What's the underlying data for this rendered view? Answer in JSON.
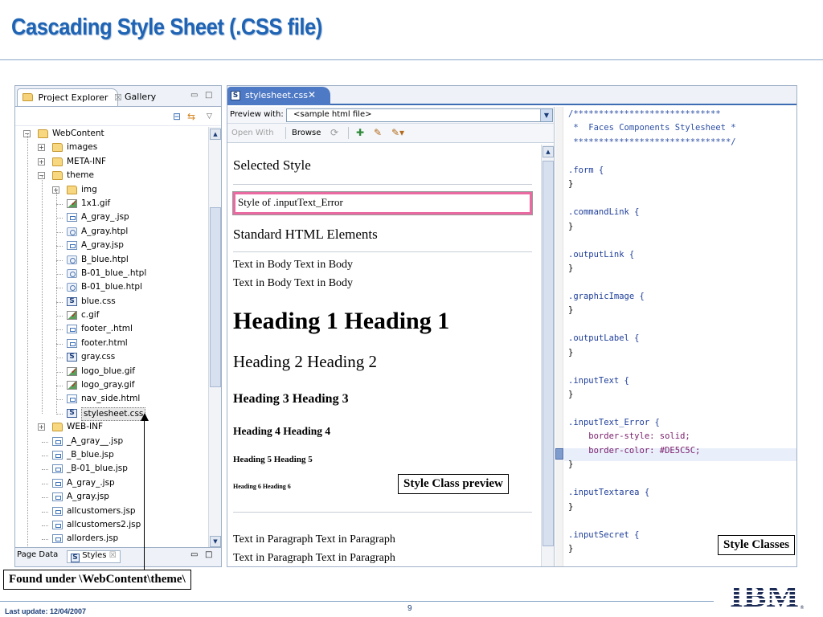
{
  "slide": {
    "title": "Cascading Style Sheet (.CSS file)",
    "footer_left": "Last update: 12/04/2007",
    "page_number": "9",
    "logo_text": "IBM"
  },
  "explorer": {
    "tabs": [
      {
        "label": "Project Explorer",
        "close": "☒",
        "icon": "folder-icon"
      },
      {
        "label": "Gallery"
      }
    ],
    "tree": [
      {
        "label": "WebContent",
        "depth": 0,
        "type": "folder",
        "expander": "−"
      },
      {
        "label": "images",
        "depth": 1,
        "type": "folder",
        "expander": "+"
      },
      {
        "label": "META-INF",
        "depth": 1,
        "type": "folder",
        "expander": "+"
      },
      {
        "label": "theme",
        "depth": 1,
        "type": "folder",
        "expander": "−"
      },
      {
        "label": "img",
        "depth": 2,
        "type": "folder",
        "expander": "+"
      },
      {
        "label": "1x1.gif",
        "depth": 2,
        "type": "gif"
      },
      {
        "label": "A_gray_.jsp",
        "depth": 2,
        "type": "file"
      },
      {
        "label": "A_gray.htpl",
        "depth": 2,
        "type": "htpl"
      },
      {
        "label": "A_gray.jsp",
        "depth": 2,
        "type": "file"
      },
      {
        "label": "B_blue.htpl",
        "depth": 2,
        "type": "htpl"
      },
      {
        "label": "B-01_blue_.htpl",
        "depth": 2,
        "type": "htpl"
      },
      {
        "label": "B-01_blue.htpl",
        "depth": 2,
        "type": "htpl"
      },
      {
        "label": "blue.css",
        "depth": 2,
        "type": "css"
      },
      {
        "label": "c.gif",
        "depth": 2,
        "type": "gif"
      },
      {
        "label": "footer_.html",
        "depth": 2,
        "type": "file"
      },
      {
        "label": "footer.html",
        "depth": 2,
        "type": "file"
      },
      {
        "label": "gray.css",
        "depth": 2,
        "type": "css"
      },
      {
        "label": "logo_blue.gif",
        "depth": 2,
        "type": "gif"
      },
      {
        "label": "logo_gray.gif",
        "depth": 2,
        "type": "gif"
      },
      {
        "label": "nav_side.html",
        "depth": 2,
        "type": "file"
      },
      {
        "label": "stylesheet.css",
        "depth": 2,
        "type": "css",
        "selected": true
      },
      {
        "label": "WEB-INF",
        "depth": 1,
        "type": "folder",
        "expander": "+"
      },
      {
        "label": "_A_gray__.jsp",
        "depth": 1,
        "type": "file"
      },
      {
        "label": "_B_blue.jsp",
        "depth": 1,
        "type": "file"
      },
      {
        "label": "_B-01_blue.jsp",
        "depth": 1,
        "type": "file"
      },
      {
        "label": "A_gray_.jsp",
        "depth": 1,
        "type": "file"
      },
      {
        "label": "A_gray.jsp",
        "depth": 1,
        "type": "file"
      },
      {
        "label": "allcustomers.jsp",
        "depth": 1,
        "type": "file"
      },
      {
        "label": "allcustomers2.jsp",
        "depth": 1,
        "type": "file"
      },
      {
        "label": "allorders.jsp",
        "depth": 1,
        "type": "file"
      }
    ],
    "lower_tabs": [
      {
        "label": "Page Data"
      },
      {
        "label": "Styles",
        "close": "☒"
      }
    ]
  },
  "editor": {
    "tab_label": "stylesheet.css",
    "tab_close": "✕",
    "tab_icon_letter": "S",
    "preview_label": "Preview with:",
    "preview_value": "<sample html file>",
    "open_with": "Open With",
    "browse": "Browse",
    "preview": {
      "selected_style_heading": "Selected Style",
      "error_style_text": "Style of .inputText_Error",
      "standard_heading": "Standard HTML Elements",
      "body_text_1": "Text in Body Text in Body",
      "body_text_2": "Text in Body Text in Body",
      "h1": "Heading 1 Heading 1",
      "h2": "Heading 2 Heading 2",
      "h3": "Heading 3 Heading 3",
      "h4": "Heading 4 Heading 4",
      "h5": "Heading 5 Heading 5",
      "h6": "Heading 6 Heading 6",
      "para_1": "Text in Paragraph Text in Paragraph",
      "para_2": "Text in Paragraph Text in Paragraph"
    },
    "source_lines": [
      "/*****************************",
      " *  Faces Components Stylesheet *",
      " *******************************/",
      "",
      ".form {",
      "}",
      "",
      ".commandLink {",
      "}",
      "",
      ".outputLink {",
      "}",
      "",
      ".graphicImage {",
      "}",
      "",
      ".outputLabel {",
      "}",
      "",
      ".inputText {",
      "}",
      "",
      ".inputText_Error {",
      "    border-style: solid;",
      "    border-color: #DE5C5C;",
      "}",
      "",
      ".inputTextarea {",
      "}",
      "",
      ".inputSecret {",
      "}"
    ]
  },
  "callouts": {
    "style_class_preview": "Style Class preview",
    "style_classes": "Style Classes",
    "found_under": "Found under \\WebContent\\theme\\"
  },
  "colors": {
    "title_blue": "#1f64b4",
    "error_border": "#e86aa0",
    "tab_active": "#4e79c4"
  }
}
